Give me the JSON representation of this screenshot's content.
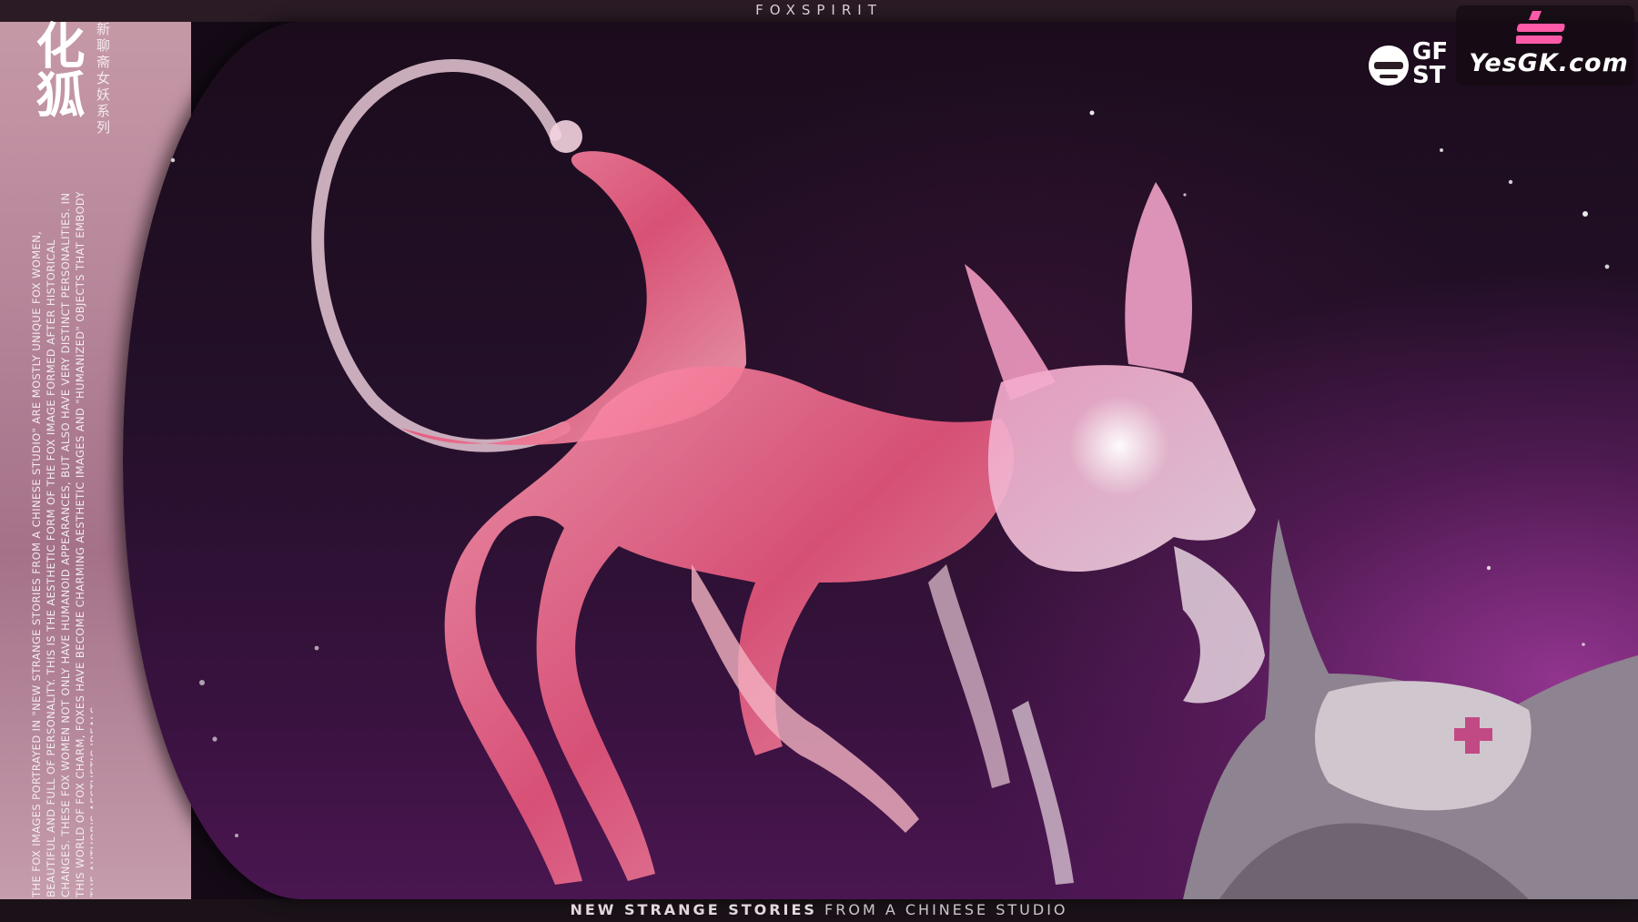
{
  "header": {
    "brand": "FOXSPIRIT"
  },
  "sidebar": {
    "logo_glyphs": "化狐",
    "series_title": "新聊斋女妖系列",
    "description": "THE FOX IMAGES PORTRAYED IN \"NEW STRANGE STORIES FROM A CHINESE STUDIO\" ARE MOSTLY UNIQUE FOX WOMEN, BEAUTIFUL AND FULL OF PERSONALITY. THIS IS THE AESTHETIC FORM OF THE FOX IMAGE FORMED AFTER HISTORICAL CHANGES. THESE FOX WOMEN NOT ONLY HAVE HUMANOID APPEARANCES, BUT ALSO HAVE VERY DISTINCT PERSONALITIES. IN THIS WORLD OF FOX CHARM, FOXES HAVE BECOME CHARMING AESTHETIC IMAGES AND \"HUMANIZED\" OBJECTS THAT EMBODY THE AUTHOR'S AESTHETIC IDEALS."
  },
  "footer": {
    "tagline_strong": "NEW STRANGE STORIES",
    "tagline_light": "FROM A CHINESE STUDIO"
  },
  "studio_logo": {
    "text_line1": "GF",
    "text_line2": "ST"
  },
  "watermark": {
    "text": "YesGK.com"
  },
  "colors": {
    "accent_pink": "#ff5aa8",
    "fox_pink": "#f07a9c",
    "background_purple": "#3a1240"
  }
}
